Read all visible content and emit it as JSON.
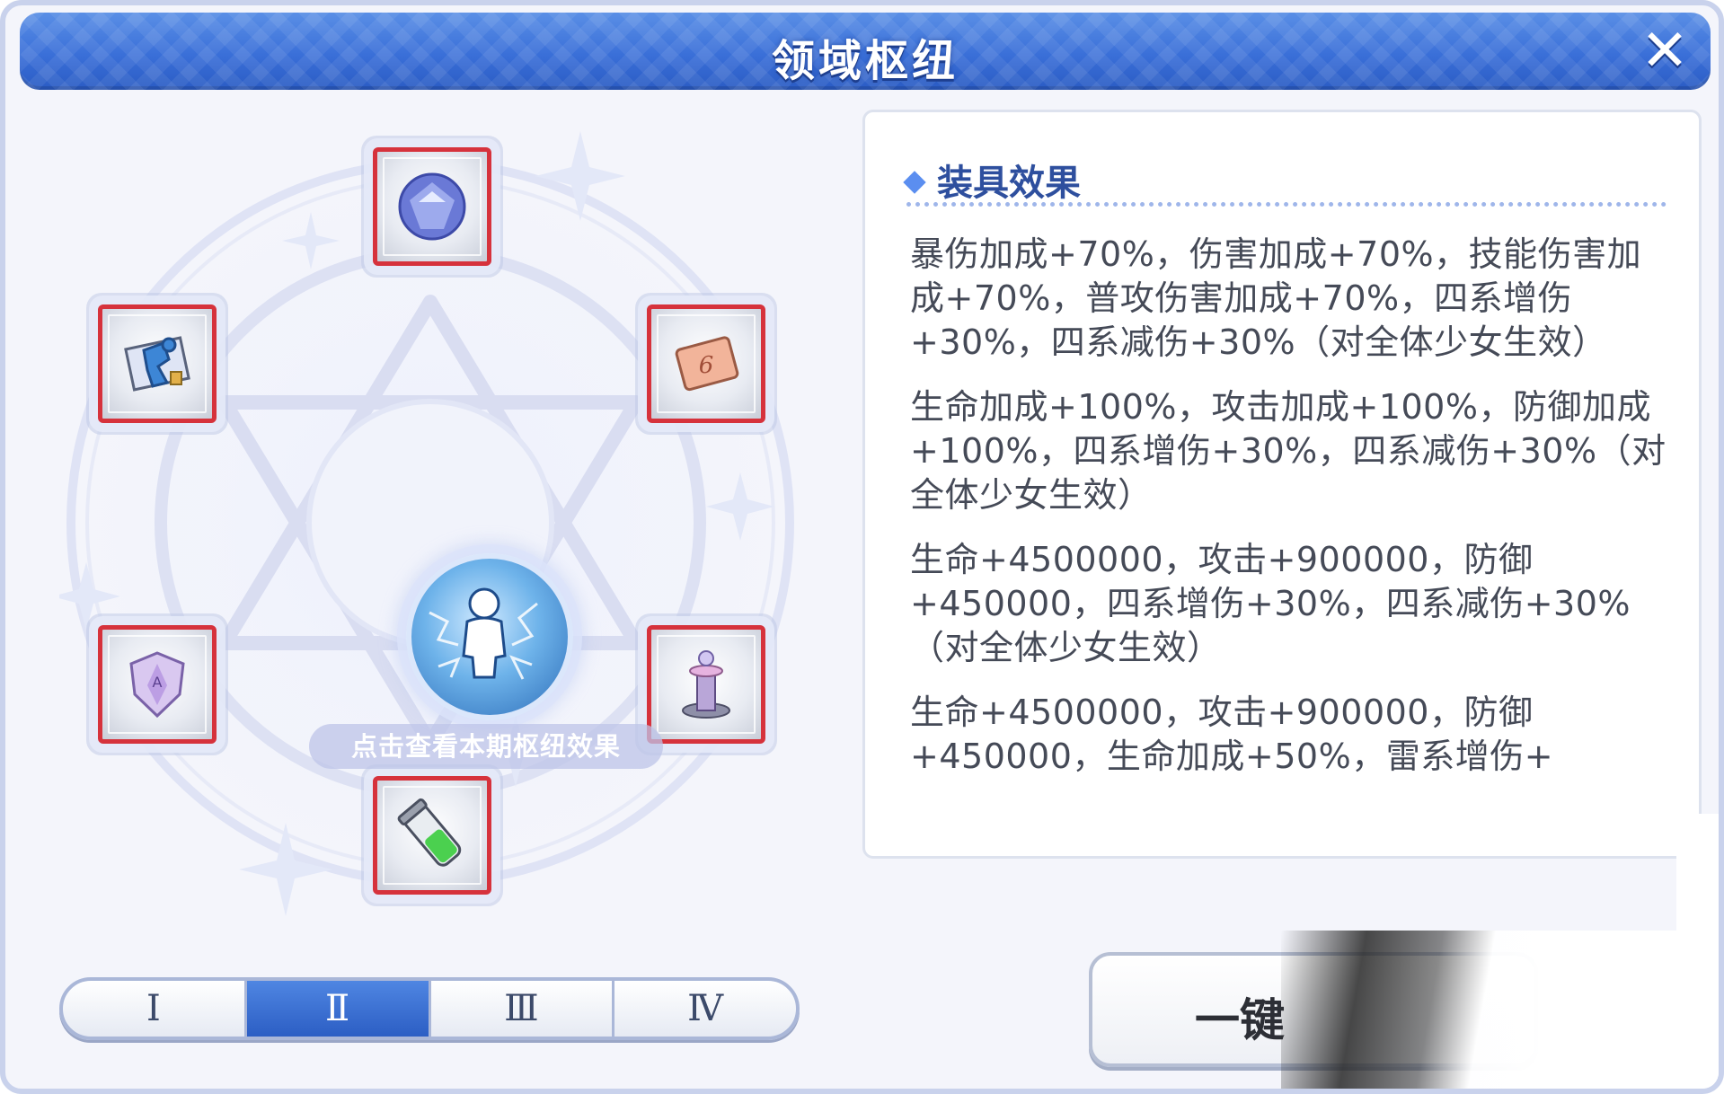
{
  "window": {
    "title": "领域枢纽",
    "close_symbol": "✕"
  },
  "center": {
    "caption": "点击查看本期枢纽效果",
    "icon": "electric-figure-orb-icon"
  },
  "nodes": [
    {
      "position": "top",
      "icon": "crystal-orb-icon"
    },
    {
      "position": "upper-left",
      "icon": "blue-key-scroll-icon"
    },
    {
      "position": "upper-right",
      "icon": "card-six-icon"
    },
    {
      "position": "lower-left",
      "icon": "crystal-shield-icon"
    },
    {
      "position": "lower-right",
      "icon": "tower-icon"
    },
    {
      "position": "bottom",
      "icon": "green-vial-icon"
    }
  ],
  "tabs": {
    "items": [
      "Ⅰ",
      "Ⅱ",
      "Ⅲ",
      "Ⅳ"
    ],
    "active_index": 1
  },
  "effects": {
    "heading": "装具效果",
    "items": [
      "暴伤加成+70%，伤害加成+70%，技能伤害加成+70%，普攻伤害加成+70%，四系增伤+30%，四系减伤+30%（对全体少女生效）",
      "生命加成+100%，攻击加成+100%，防御加成+100%，四系增伤+30%，四系减伤+30%（对全体少女生效）",
      "生命+4500000，攻击+900000，防御+450000，四系增伤+30%，四系减伤+30%（对全体少女生效）",
      "生命+4500000，攻击+900000，防御+450000，生命加成+50%，雷系增伤+"
    ]
  },
  "onekey_button": {
    "label": "一键"
  },
  "colors": {
    "title_bar": "#3a6fd8",
    "node_border": "#d6323c",
    "tab_active": "#2c5ec4",
    "effect_heading": "#2e4f9e"
  }
}
